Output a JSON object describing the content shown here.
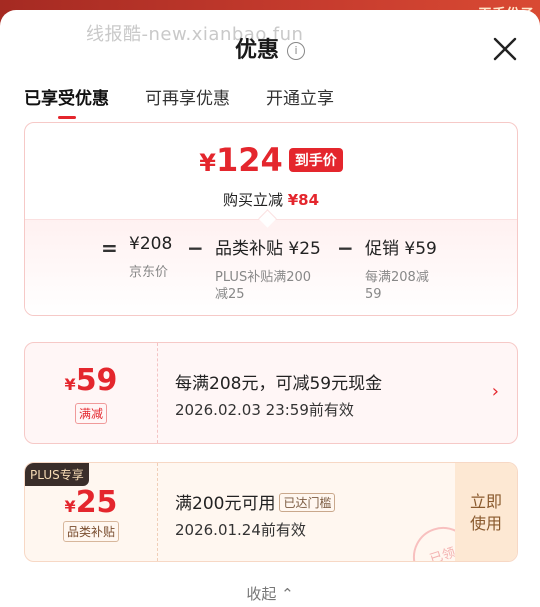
{
  "background": {
    "right_text": "天手份子"
  },
  "watermark": "线报酷-new.xianbao.fun",
  "sheet": {
    "title": "优惠",
    "info_icon": "i",
    "close_label": "close"
  },
  "tabs": [
    {
      "label": "已享受优惠"
    },
    {
      "label": "可再享优惠"
    },
    {
      "label": "开通立享"
    }
  ],
  "summary": {
    "currency": "¥",
    "final_price": "124",
    "final_badge": "到手价",
    "save_label": "购买立减",
    "save_amount": "¥84",
    "formula": {
      "eq": "=",
      "minus1": "−",
      "minus2": "−",
      "items": [
        {
          "value": "¥208",
          "sub": "京东价"
        },
        {
          "value": "品类补贴 ¥25",
          "sub": "PLUS补贴满200\n减25"
        },
        {
          "value": "促销 ¥59",
          "sub": "每满208减\n59"
        }
      ]
    }
  },
  "coupons": [
    {
      "currency": "¥",
      "amount": "59",
      "tag": "满减",
      "line1": "每满208元，可减59元现金",
      "line2": "2026.02.03 23:59前有效",
      "chevron": "›"
    },
    {
      "plus_badge": "PLUS专享",
      "currency": "¥",
      "amount": "25",
      "tag": "品类补贴",
      "line1": "满200元可用",
      "met_badge": "已达门槛",
      "line2": "2026.01.24前有效",
      "action_line1": "立即",
      "action_line2": "使用",
      "stamp": "已领"
    }
  ],
  "collapse_label": "收起 ⌃",
  "colors": {
    "accent": "#e4262d",
    "plus_dark": "#3a2e2a",
    "gold_bg": "#fde8d3"
  }
}
